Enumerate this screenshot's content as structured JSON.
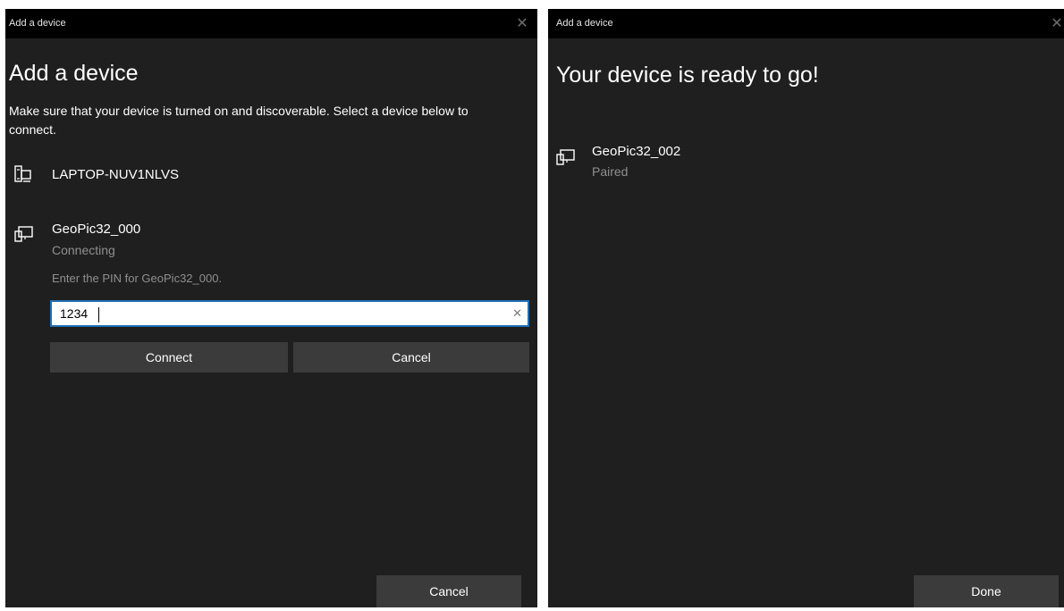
{
  "left_dialog": {
    "window_title": "Add a device",
    "heading": "Add a device",
    "instructions": "Make sure that your device is turned on and discoverable. Select a device below to connect.",
    "devices": [
      {
        "name": "LAPTOP-NUV1NLVS",
        "icon": "computer-icon"
      },
      {
        "name": "GeoPic32_000",
        "status": "Connecting",
        "icon": "device-icon"
      }
    ],
    "pin_prompt": "Enter the PIN for GeoPic32_000.",
    "pin_value": "1234",
    "connect_label": "Connect",
    "inline_cancel_label": "Cancel",
    "footer_cancel_label": "Cancel"
  },
  "right_dialog": {
    "window_title": "Add a device",
    "heading": "Your device is ready to go!",
    "device": {
      "name": "GeoPic32_002",
      "status": "Paired",
      "icon": "device-icon"
    },
    "done_label": "Done"
  },
  "colors": {
    "background": "#1f1f1f",
    "titlebar": "#000000",
    "button": "#3b3b3b",
    "secondary_text": "#8f8f8f",
    "input_border": "#1f6fb4"
  }
}
